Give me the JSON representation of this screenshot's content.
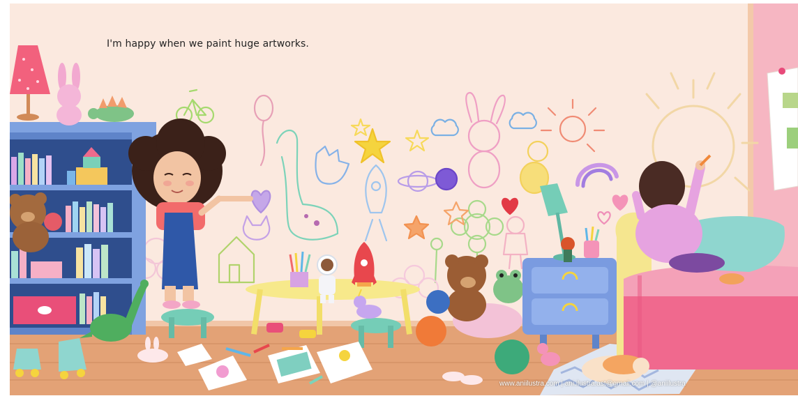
{
  "caption": "I'm happy when we paint huge artworks.",
  "credits": "www.aniilustra.com | ani.ilustra.ast@gmail.com | @aniilustra",
  "colors": {
    "wall": "#fbe9df",
    "floor": "#e3a276",
    "shelf": "#6f93d3",
    "bed_blanket": "#f0698e",
    "pillow": "#8fd6cf",
    "pink_wall": "#f6b6c2",
    "overalls": "#2f58a8",
    "table": "#f7e98b",
    "stool": "#75cdb7",
    "nightstand": "#7a9be0"
  },
  "icons": [
    "lamp-icon",
    "bunny-plush-icon",
    "stegosaurus-toy-icon",
    "teddy-bear-icon",
    "rocket-toy-icon",
    "astronaut-doll-icon",
    "unicorn-toy-icon",
    "frog-plush-icon",
    "cat-sleeping-icon",
    "roller-skates-icon",
    "dinosaur-toy-icon",
    "pony-toy-icon",
    "ball-icon",
    "crayon-cup-icon"
  ]
}
